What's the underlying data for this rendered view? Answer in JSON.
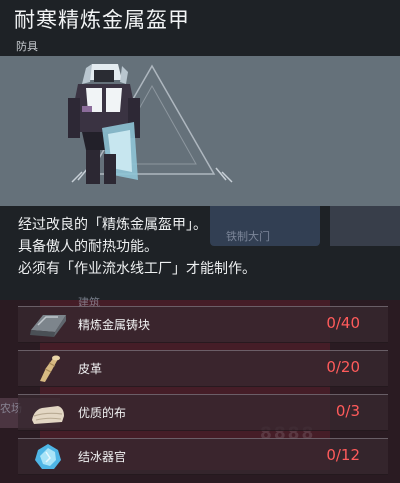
{
  "item": {
    "title": "耐寒精炼金属盔甲",
    "category": "防具",
    "description": [
      "经过改良的「精炼金属盔甲」。",
      "具备傲人的耐热功能。",
      "必须有「作业流水线工厂」才能制作。"
    ]
  },
  "background": {
    "door_label": "铁制大门",
    "build_label": "建筑",
    "left_fragment": "农场",
    "ghost_number": "8888"
  },
  "ingredients": [
    {
      "name": "精炼金属铸块",
      "count": "0/40",
      "icon": "metal-ingot-icon"
    },
    {
      "name": "皮革",
      "count": "0/20",
      "icon": "leather-icon"
    },
    {
      "name": "优质的布",
      "count": "0/3",
      "icon": "fine-cloth-icon"
    },
    {
      "name": "结冰器官",
      "count": "0/12",
      "icon": "frozen-organ-icon"
    }
  ],
  "colors": {
    "missing_count": "#ff5b5b",
    "preview_bg": "#65717a"
  }
}
